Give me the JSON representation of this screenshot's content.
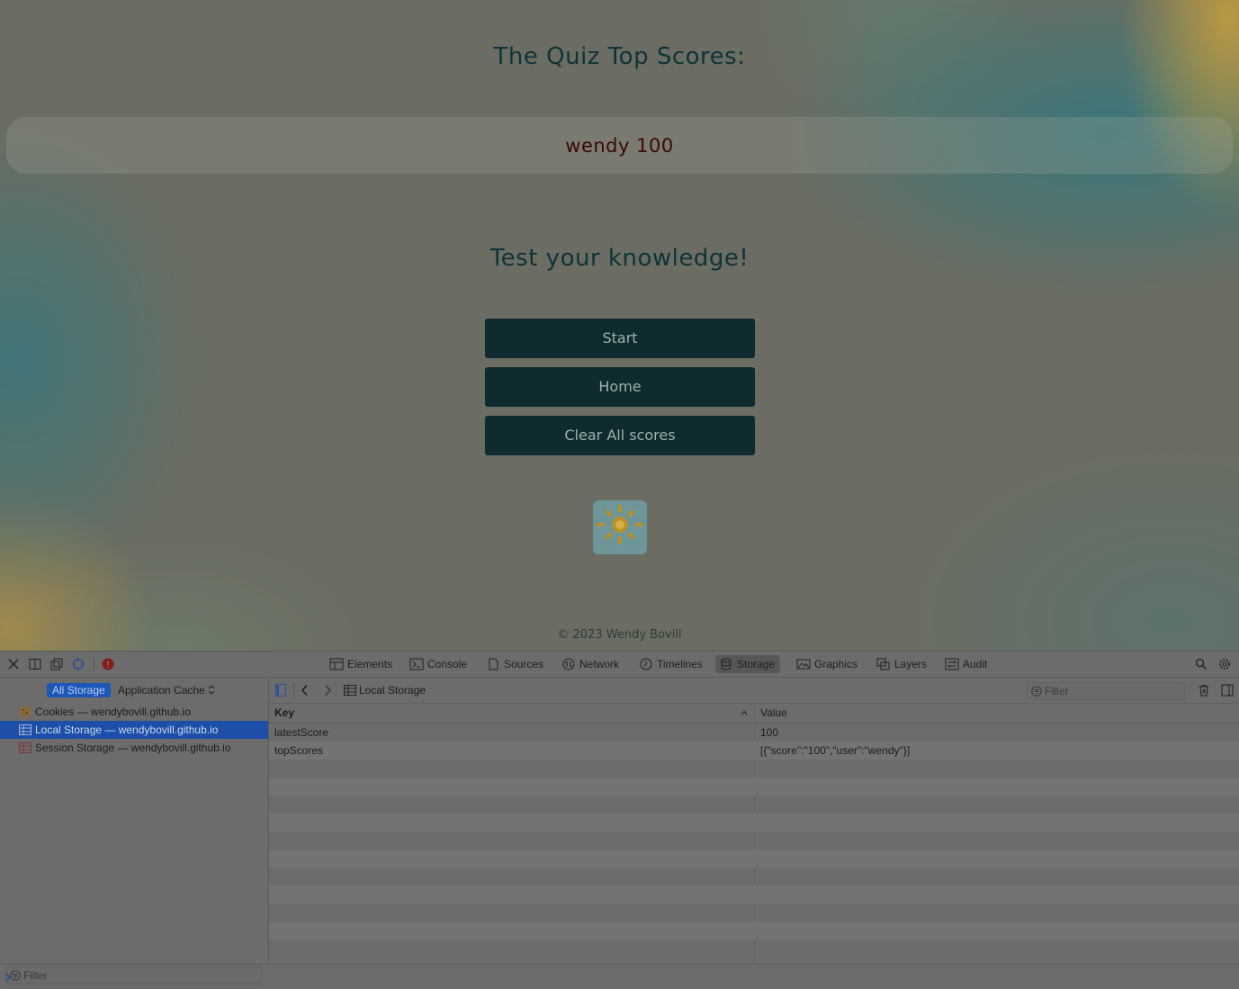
{
  "page": {
    "heading": "The Quiz Top Scores:",
    "score_entry": "wendy 100",
    "subheading": "Test your knowledge!",
    "buttons": {
      "start": "Start",
      "home": "Home",
      "clear": "Clear All scores"
    },
    "sun_icon": "sun-icon",
    "footer": "© 2023 Wendy Bovill"
  },
  "devtools": {
    "tabs": [
      {
        "label": "Elements",
        "icon": "elements-icon"
      },
      {
        "label": "Console",
        "icon": "console-icon"
      },
      {
        "label": "Sources",
        "icon": "sources-icon"
      },
      {
        "label": "Network",
        "icon": "network-icon"
      },
      {
        "label": "Timelines",
        "icon": "timelines-icon"
      },
      {
        "label": "Storage",
        "icon": "storage-icon",
        "active": true
      },
      {
        "label": "Graphics",
        "icon": "graphics-icon"
      },
      {
        "label": "Layers",
        "icon": "layers-icon"
      },
      {
        "label": "Audit",
        "icon": "audit-icon"
      }
    ],
    "sidebar": {
      "scope_all": "All Storage",
      "scope_other": "Application Cache",
      "items": [
        {
          "label": "Cookies — wendybovill.github.io",
          "icon": "cookie-icon"
        },
        {
          "label": "Local Storage — wendybovill.github.io",
          "icon": "storage-table-icon",
          "selected": true
        },
        {
          "label": "Session Storage — wendybovill.github.io",
          "icon": "storage-table-icon"
        }
      ],
      "filter_placeholder": "Filter"
    },
    "content": {
      "breadcrumb": "Local Storage",
      "filter_placeholder": "Filter",
      "columns": {
        "key": "Key",
        "value": "Value"
      },
      "rows": [
        {
          "key": "latestScore",
          "value": "100"
        },
        {
          "key": "topScores",
          "value": "[{\"score\":\"100\",\"user\":\"wendy\"}]"
        }
      ]
    },
    "colors": {
      "selection": "#1d4fa8",
      "button": "#0f2b30",
      "heading": "#0e3438"
    }
  }
}
